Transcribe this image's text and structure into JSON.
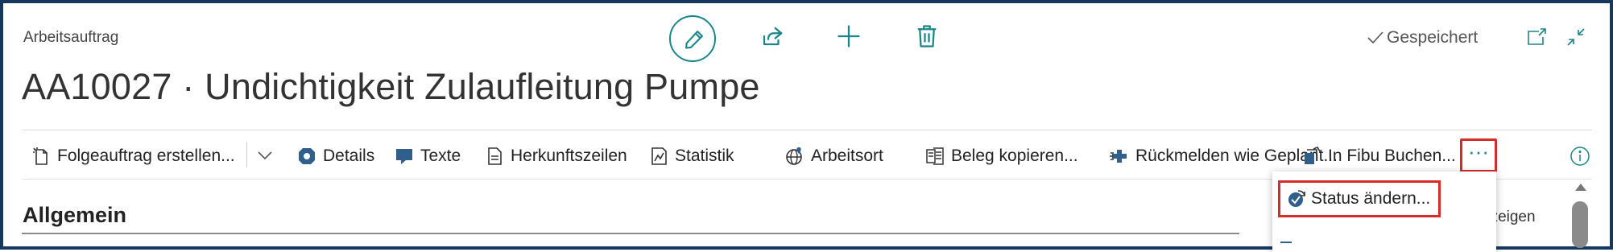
{
  "header": {
    "entity_type": "Arbeitsauftrag",
    "title": "AA10027 · Undichtigkeit Zulaufleitung Pumpe",
    "saved_status": "Gespeichert"
  },
  "toolbar": {
    "icons": [
      "edit-icon",
      "share-icon",
      "add-icon",
      "delete-icon",
      "open-new-window-icon",
      "collapse-icon"
    ]
  },
  "actions": [
    {
      "label": "Folgeauftrag erstellen...",
      "icon": "new-document-icon"
    },
    {
      "label": "Details",
      "icon": "details-icon"
    },
    {
      "label": "Texte",
      "icon": "text-icon"
    },
    {
      "label": "Herkunftszeilen",
      "icon": "document-icon"
    },
    {
      "label": "Statistik",
      "icon": "statistics-icon"
    },
    {
      "label": "Arbeitsort",
      "icon": "globe-icon"
    },
    {
      "label": "Beleg kopieren...",
      "icon": "copy-document-icon"
    },
    {
      "label": "Rückmelden wie Geplant...",
      "icon": "post-icon"
    },
    {
      "label": "In Fibu Buchen...",
      "icon": "post-to-gl-icon"
    }
  ],
  "more_button": {
    "label": "···"
  },
  "dropdown": {
    "items": [
      {
        "label": "Status ändern...",
        "icon": "status-change-icon"
      }
    ]
  },
  "section": {
    "title": "Allgemein",
    "show_more_partial": "nzeigen"
  },
  "colors": {
    "accent": "#18868b",
    "frame": "#17385e",
    "highlight": "#d62b2b"
  }
}
